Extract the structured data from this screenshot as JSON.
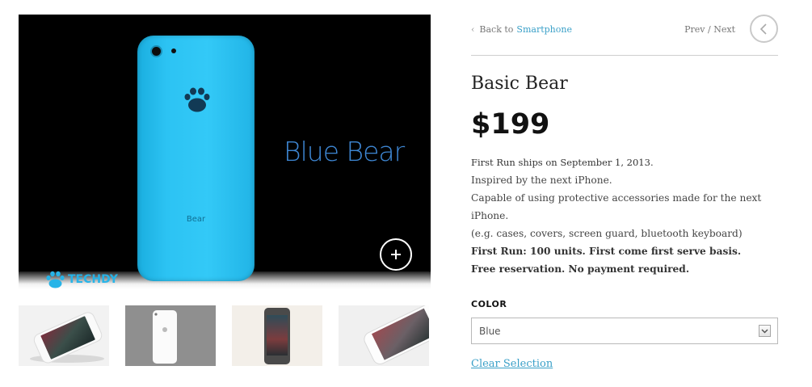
{
  "gallery": {
    "hero_caption": "Blue Bear",
    "phone_brand": "Bear",
    "logo_text": "TECHDY",
    "thumbnails": [
      "phone-white-lying",
      "phone-white-back",
      "phone-grey-standing",
      "phone-white-angled"
    ]
  },
  "nav": {
    "back_prefix": "Back to",
    "back_link": "Smartphone",
    "prev": "Prev",
    "separator": "/",
    "next": "Next"
  },
  "product": {
    "title": "Basic Bear",
    "price": "$199",
    "ship_note": "First Run ships on September 1, 2013.",
    "desc_lines": [
      "Inspired by the next iPhone.",
      "Capable of using protective accessories made for the next iPhone.",
      "(e.g. cases, covers, screen guard, bluetooth keyboard)"
    ],
    "bold_lines": [
      "First Run: 100 units. First come first serve basis.",
      "Free reservation. No payment required."
    ]
  },
  "options": {
    "color_label": "COLOR",
    "color_selected": "Blue",
    "clear_label": "Clear Selection"
  },
  "colors": {
    "accent": "#3aa0c8",
    "phone_blue": "#33c9f7",
    "caption_blue": "#3e87d4"
  }
}
